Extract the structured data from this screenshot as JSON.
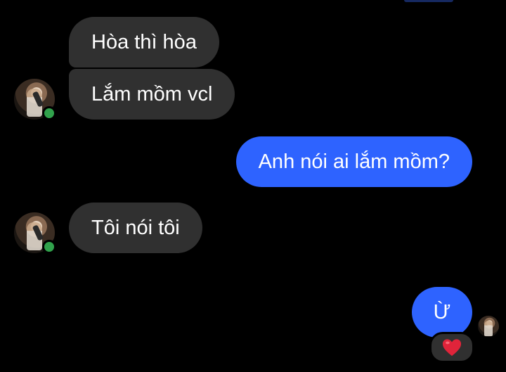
{
  "messages": [
    {
      "id": "m1",
      "direction": "incoming",
      "text": "Hòa thì hòa"
    },
    {
      "id": "m2",
      "direction": "incoming",
      "text": "Lắm mồm vcl"
    },
    {
      "id": "m3",
      "direction": "outgoing",
      "text": "Anh nói ai lắm mồm?"
    },
    {
      "id": "m4",
      "direction": "incoming",
      "text": "Tôi nói tôi"
    },
    {
      "id": "m5",
      "direction": "outgoing",
      "text": "Ừ"
    }
  ],
  "reaction": {
    "icon": "heart-icon",
    "color": "#e0243a"
  },
  "colors": {
    "background": "#000000",
    "incoming_bubble": "#303030",
    "outgoing_bubble": "#2e63ff",
    "online_dot": "#31a24c",
    "text": "#ffffff"
  }
}
